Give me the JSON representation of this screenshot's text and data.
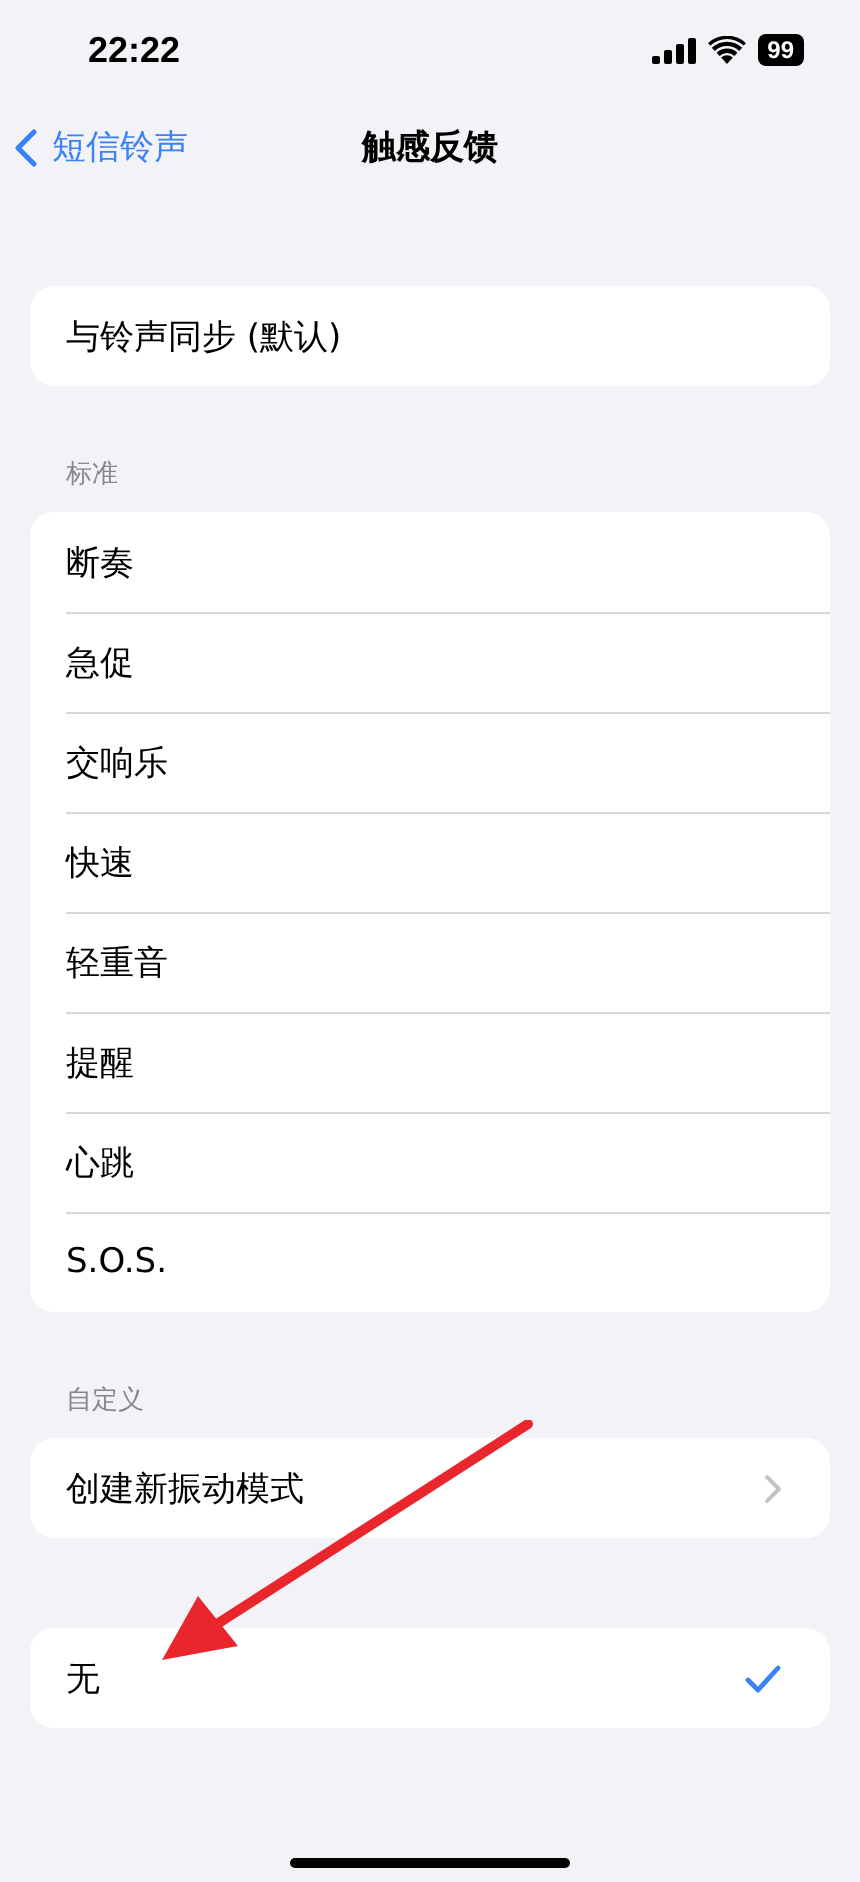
{
  "status_bar": {
    "time": "22:22",
    "battery": "99"
  },
  "nav": {
    "back": "短信铃声",
    "title": "触感反馈"
  },
  "sections": [
    {
      "items": [
        {
          "label": "与铃声同步 (默认)",
          "kind": "option",
          "selected": false
        }
      ]
    },
    {
      "header": "标准",
      "items": [
        {
          "label": "断奏",
          "kind": "option",
          "selected": false
        },
        {
          "label": "急促",
          "kind": "option",
          "selected": false
        },
        {
          "label": "交响乐",
          "kind": "option",
          "selected": false
        },
        {
          "label": "快速",
          "kind": "option",
          "selected": false
        },
        {
          "label": "轻重音",
          "kind": "option",
          "selected": false
        },
        {
          "label": "提醒",
          "kind": "option",
          "selected": false
        },
        {
          "label": "心跳",
          "kind": "option",
          "selected": false
        },
        {
          "label": "S.O.S.",
          "kind": "option",
          "selected": false
        }
      ]
    },
    {
      "header": "自定义",
      "items": [
        {
          "label": "创建新振动模式",
          "kind": "link"
        }
      ]
    },
    {
      "items": [
        {
          "label": "无",
          "kind": "option",
          "selected": true
        }
      ]
    }
  ]
}
